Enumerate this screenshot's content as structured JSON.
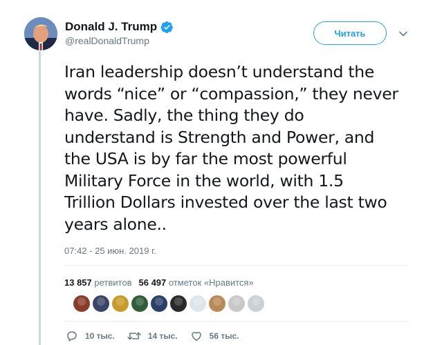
{
  "author": {
    "name": "Donald J. Trump",
    "handle": "@realDonaldTrump",
    "verified": true
  },
  "follow_label": "Читать",
  "tweet_text": "Iran leadership doesn’t understand the\nwords “nice” or “compassion,” they never\nhave. Sadly, the thing they do\nunderstand is Strength and Power, and\nthe USA is by far the most powerful\nMilitary Force in the world, with 1.5\nTrillion Dollars invested over the last two\nyears alone..",
  "timestamp": "07:42 - 25 июн. 2019 г.",
  "stats": {
    "retweets_count": "13 857",
    "retweets_label": "ретвитов",
    "likes_count": "56 497",
    "likes_label": "отметок «Нравится»"
  },
  "actions": {
    "replies": "10 тыс.",
    "retweets": "14 тыс.",
    "likes": "56 тыс."
  },
  "colors": {
    "accent": "#1da1f2",
    "text": "#14171a",
    "secondary": "#657786",
    "divider": "#e6ecf0"
  },
  "liker_colors": [
    "#8a3b2a",
    "#3a4466",
    "#c89a2a",
    "#2f5c3a",
    "#2b3f6b",
    "#2a2a2a",
    "#dfe6ea",
    "#b88a55",
    "#c8c8c8",
    "#c9d1d8"
  ]
}
